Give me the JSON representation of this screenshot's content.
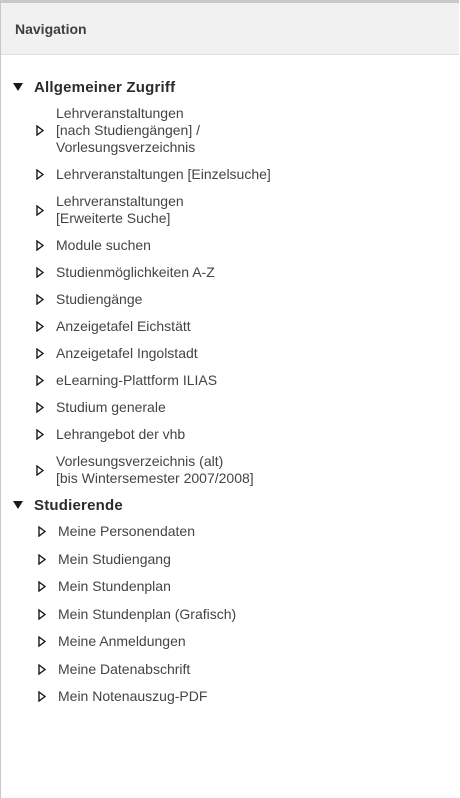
{
  "panel": {
    "title": "Navigation"
  },
  "groups": [
    {
      "label": "Allgemeiner Zugriff",
      "items": [
        {
          "label": "Lehrveranstaltungen\n[nach Studiengängen] /\nVorlesungsverzeichnis"
        },
        {
          "label": "Lehrveranstaltungen [Einzelsuche]"
        },
        {
          "label": "Lehrveranstaltungen\n[Erweiterte Suche]"
        },
        {
          "label": "Module suchen"
        },
        {
          "label": "Studienmöglichkeiten A-Z"
        },
        {
          "label": "Studiengänge"
        },
        {
          "label": "Anzeigetafel Eichstätt"
        },
        {
          "label": "Anzeigetafel Ingolstadt"
        },
        {
          "label": "eLearning-Plattform ILIAS"
        },
        {
          "label": "Studium generale"
        },
        {
          "label": "Lehrangebot der vhb"
        },
        {
          "label": "Vorlesungsverzeichnis (alt)\n[bis Wintersemester 2007/2008]"
        }
      ]
    },
    {
      "label": "Studierende",
      "items": [
        {
          "label": "Meine Personendaten"
        },
        {
          "label": "Mein Studiengang"
        },
        {
          "label": "Mein Stundenplan"
        },
        {
          "label": "Mein Stundenplan (Grafisch)"
        },
        {
          "label": "Meine Anmeldungen"
        },
        {
          "label": "Meine Datenabschrift"
        },
        {
          "label": "Mein Notenauszug-PDF"
        }
      ]
    }
  ],
  "icons": {
    "expanded": "triangle-down-icon",
    "collapsed": "triangle-right-outline-icon"
  }
}
